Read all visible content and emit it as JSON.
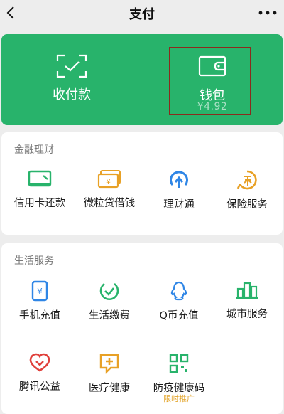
{
  "nav": {
    "title": "支付"
  },
  "hero": {
    "receive_label": "收付款",
    "wallet_label": "钱包",
    "wallet_balance": "¥4.92"
  },
  "finance": {
    "title": "金融理财",
    "items": [
      {
        "label": "信用卡还款",
        "icon": "credit-card-icon"
      },
      {
        "label": "微粒贷借钱",
        "icon": "loan-icon"
      },
      {
        "label": "理财通",
        "icon": "wealth-icon"
      },
      {
        "label": "保险服务",
        "icon": "insurance-icon"
      }
    ]
  },
  "life": {
    "title": "生活服务",
    "items": [
      {
        "label": "手机充值",
        "icon": "mobile-topup-icon"
      },
      {
        "label": "生活缴费",
        "icon": "bill-payment-icon"
      },
      {
        "label": "Q币充值",
        "icon": "qcoin-icon"
      },
      {
        "label": "城市服务",
        "icon": "city-service-icon"
      },
      {
        "label": "腾讯公益",
        "icon": "charity-icon"
      },
      {
        "label": "医疗健康",
        "icon": "medical-icon"
      },
      {
        "label": "防疫健康码",
        "icon": "health-code-icon"
      }
    ],
    "promo_text": "限时推广"
  },
  "colors": {
    "green": "#28b36b",
    "orange": "#e8a126",
    "blue": "#2f86e6",
    "red": "#e0413c",
    "highlight": "#8b2a1d"
  }
}
